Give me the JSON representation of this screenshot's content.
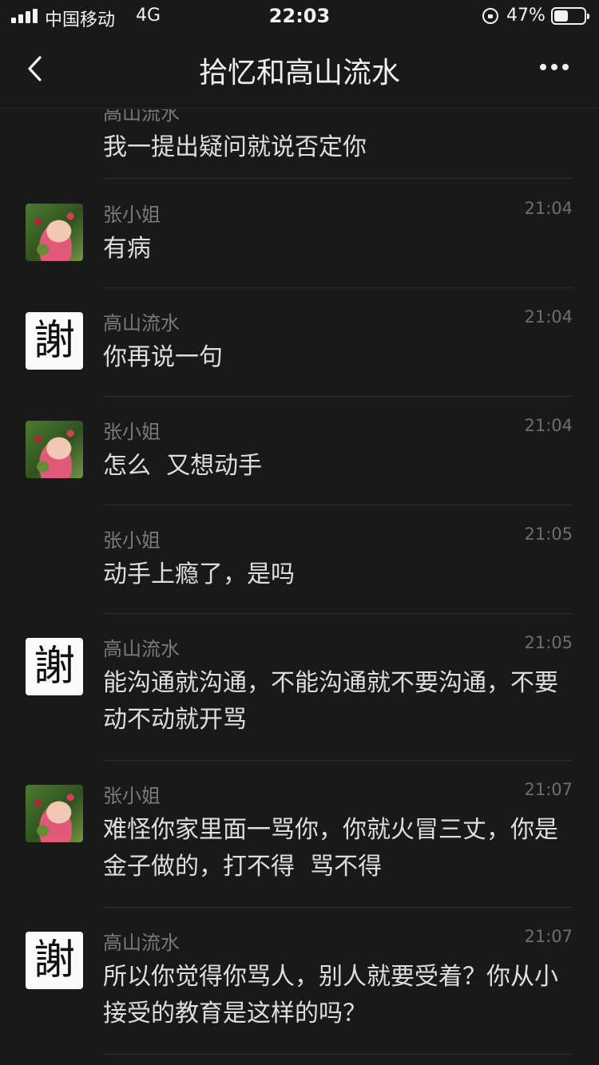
{
  "status": {
    "carrier": "中国移动",
    "network": "4G",
    "time": "22:03",
    "battery_percent": "47%",
    "battery_level": 0.47
  },
  "nav": {
    "title": "拾忆和高山流水"
  },
  "first_message": {
    "sender": "高山流水",
    "text": "我一提出疑问就说否定你"
  },
  "messages": [
    {
      "sender": "张小姐",
      "time": "21:04",
      "text": "有病",
      "avatar": "photo-avatar"
    },
    {
      "sender": "高山流水",
      "time": "21:04",
      "text": "你再说一句",
      "avatar": "謝"
    },
    {
      "sender": "张小姐",
      "time": "21:04",
      "text": "怎么  又想动手",
      "avatar": "photo-avatar"
    },
    {
      "sender": "张小姐",
      "time": "21:05",
      "text": "动手上瘾了，是吗",
      "avatar": ""
    },
    {
      "sender": "高山流水",
      "time": "21:05",
      "text": "能沟通就沟通，不能沟通就不要沟通，不要动不动就开骂",
      "avatar": "謝"
    },
    {
      "sender": "张小姐",
      "time": "21:07",
      "text": "难怪你家里面一骂你，你就火冒三丈，你是金子做的，打不得  骂不得",
      "avatar": "photo-avatar"
    },
    {
      "sender": "高山流水",
      "time": "21:07",
      "text": "所以你觉得你骂人，别人就要受着？你从小接受的教育是这样的吗？",
      "avatar": "謝"
    }
  ]
}
